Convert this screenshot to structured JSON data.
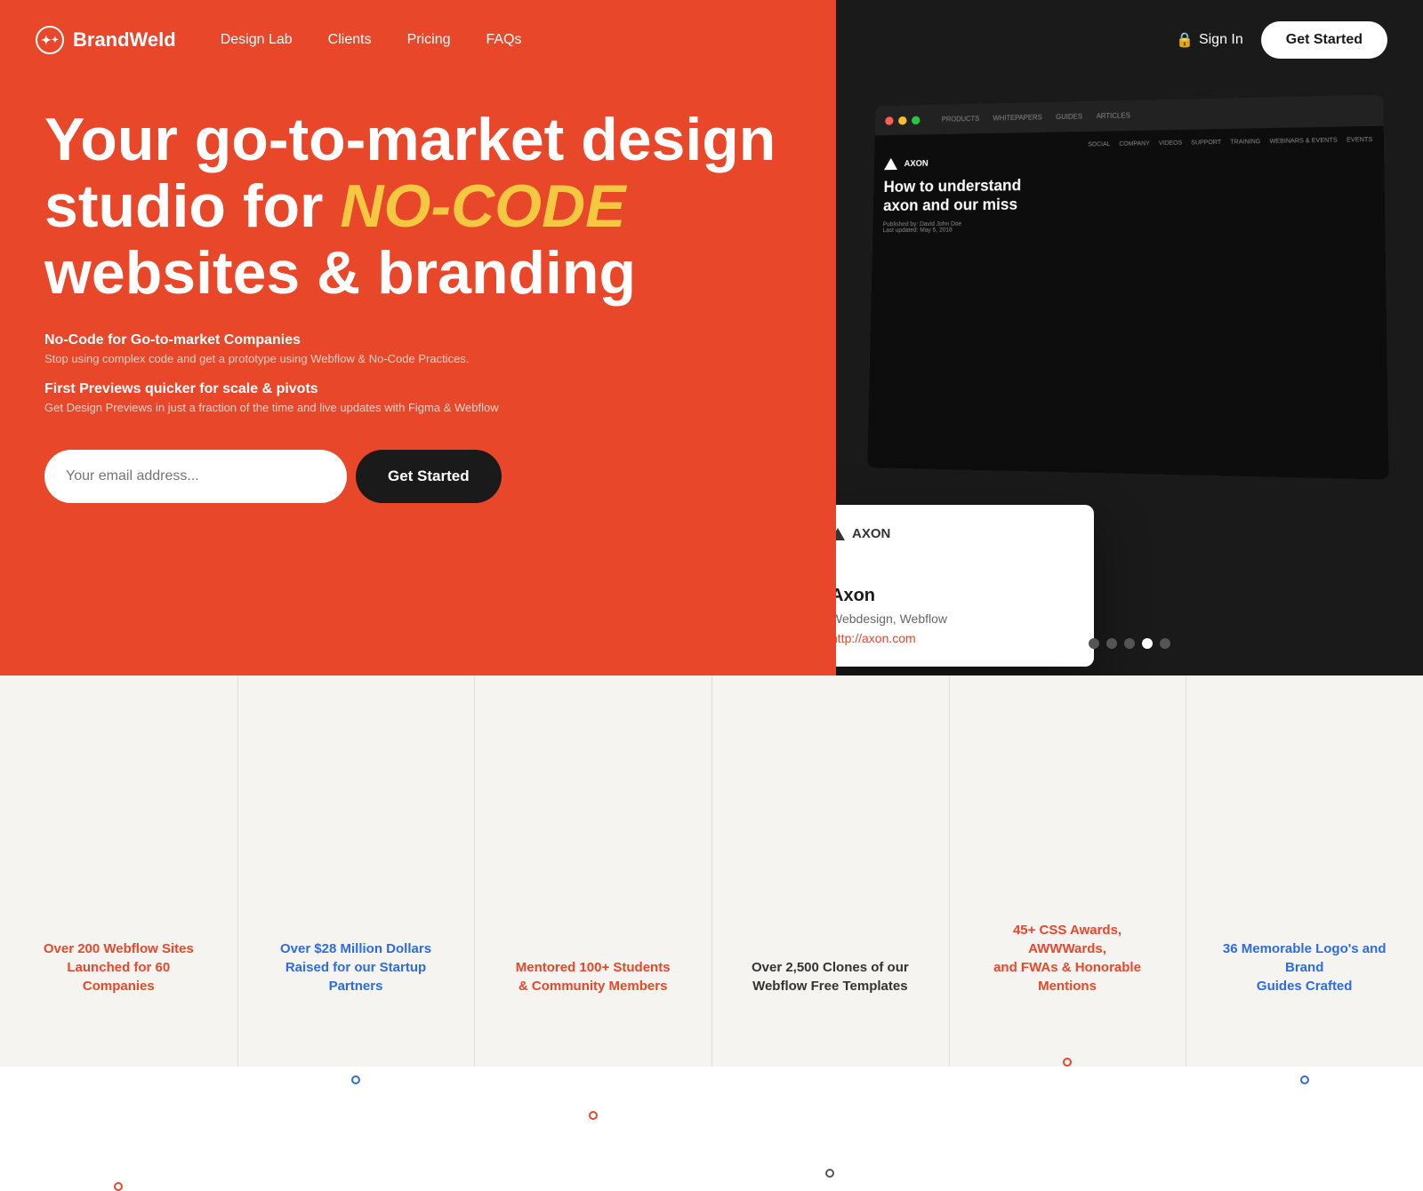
{
  "brand": {
    "name": "BrandWeld"
  },
  "nav": {
    "links": [
      {
        "label": "Design Lab",
        "href": "#"
      },
      {
        "label": "Clients",
        "href": "#"
      },
      {
        "label": "Pricing",
        "href": "#"
      },
      {
        "label": "FAQs",
        "href": "#"
      }
    ],
    "signin_label": "Sign In",
    "get_started_label": "Get Started"
  },
  "hero": {
    "headline_1": "Your go-to-market design",
    "headline_2": "studio for ",
    "headline_highlight": "NO-CODE",
    "headline_3": " websites & branding",
    "feature_1_title": "No-Code for Go-to-market Companies",
    "feature_1_desc": "Stop using complex code and get a prototype using Webflow & No-Code Practices.",
    "feature_2_title": "First Previews quicker for scale & pivots",
    "feature_2_desc": "Get Design Previews in just a fraction of the time and live updates with Figma & Webflow",
    "email_placeholder": "Your email address...",
    "cta_label": "Get Started"
  },
  "card": {
    "logo_text": "AXON",
    "title": "Axon",
    "subtitle": "Webdesign, Webflow",
    "link": "http://axon.com"
  },
  "stats": [
    {
      "text": "Over 200 Webflow Sites\nLaunched for 60 Companies",
      "color": "stat-orange"
    },
    {
      "text": "Over $28 Million Dollars\nRaised for our Startup Partners",
      "color": "stat-blue"
    },
    {
      "text": "Mentored 100+ Students\n& Community Members",
      "color": "stat-orange"
    },
    {
      "text": "Over 2,500 Clones of our\nWebflow Free Templates",
      "color": "stat-dark"
    },
    {
      "text": "45+ CSS Awards, AWWWards,\nand FWAs & Honorable\nMentions",
      "color": "stat-orange"
    },
    {
      "text": "36 Memorable Logo's and Brand\nGuides Crafted",
      "color": "stat-blue"
    }
  ],
  "mockup": {
    "dark_heading": "How to understand\naxon and our miss",
    "nav_items": [
      "PRODUCTS",
      "WHITEPAPERS",
      "GUIDES",
      "ARTICLES"
    ],
    "top_items": [
      "SOCIAL",
      "COMPANY",
      "VIDEOS",
      "SUPPORT",
      "TRAINING",
      "WEBINARS & EVENTS",
      "EVENTS"
    ]
  },
  "carousel": {
    "dots": [
      {
        "active": false
      },
      {
        "active": false
      },
      {
        "active": false
      },
      {
        "active": true
      },
      {
        "active": false
      }
    ]
  }
}
